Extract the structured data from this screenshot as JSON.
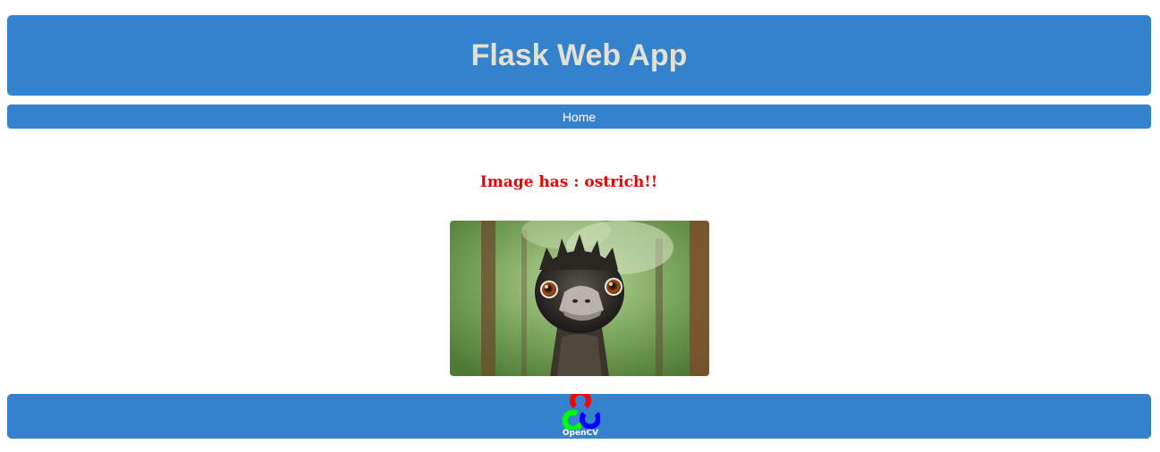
{
  "header": {
    "title": "Flask Web App"
  },
  "nav": {
    "home_label": "Home"
  },
  "main": {
    "result_text": "Image has : ostrich!!",
    "image_subject": "ostrich"
  },
  "footer": {
    "logo_text": "OpenCV",
    "logo_colors": [
      "#ff0000",
      "#00ff00",
      "#0000ff"
    ]
  },
  "colors": {
    "brand_blue": "#3481cd",
    "title_color": "#e3e1d6",
    "result_red": "#ee0000"
  }
}
